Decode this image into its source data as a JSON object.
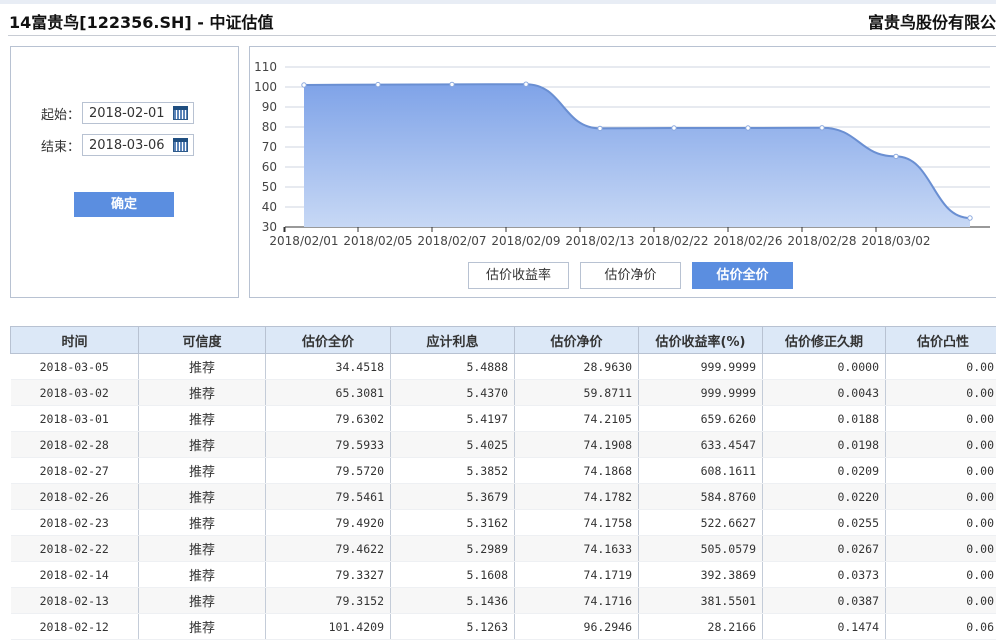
{
  "header": {
    "title": "14富贵鸟[122356.SH] - 中证估值",
    "company": "富贵鸟股份有限公"
  },
  "filter": {
    "start_label": "起始：",
    "start_value": "2018-02-01",
    "end_label": "结束：",
    "end_value": "2018-03-06",
    "confirm": "确定"
  },
  "chart_tabs": [
    {
      "label": "估价收益率"
    },
    {
      "label": "估价净价"
    },
    {
      "label": "估价全价",
      "active": true
    }
  ],
  "chart_data": {
    "type": "area",
    "title": "",
    "xlabel": "",
    "ylabel": "",
    "ylim": [
      30,
      110
    ],
    "yticks": [
      30,
      40,
      50,
      60,
      70,
      80,
      90,
      100,
      110
    ],
    "x": [
      "2018/02/01",
      "2018/02/05",
      "2018/02/07",
      "2018/02/09",
      "2018/02/13",
      "2018/02/22",
      "2018/02/26",
      "2018/02/28",
      "2018/03/02",
      "2018/03/05"
    ],
    "xtick_labels": [
      "2018/02/01",
      "2018/02/05",
      "2018/02/07",
      "2018/02/09",
      "2018/02/13",
      "2018/02/22",
      "2018/02/26",
      "2018/02/28",
      "2018/03/02"
    ],
    "values": [
      101.0,
      101.2,
      101.3,
      101.4,
      79.3,
      79.5,
      79.5,
      79.6,
      65.3,
      34.5
    ],
    "grid": true,
    "color": "#5b8ee0"
  },
  "table": {
    "headers": [
      "时间",
      "可信度",
      "估价全价",
      "应计利息",
      "估价净价",
      "估价收益率(%)",
      "估价修正久期",
      "估价凸性"
    ],
    "rows": [
      [
        "2018-03-05",
        "推荐",
        "34.4518",
        "5.4888",
        "28.9630",
        "999.9999",
        "0.0000",
        "0.00"
      ],
      [
        "2018-03-02",
        "推荐",
        "65.3081",
        "5.4370",
        "59.8711",
        "999.9999",
        "0.0043",
        "0.00"
      ],
      [
        "2018-03-01",
        "推荐",
        "79.6302",
        "5.4197",
        "74.2105",
        "659.6260",
        "0.0188",
        "0.00"
      ],
      [
        "2018-02-28",
        "推荐",
        "79.5933",
        "5.4025",
        "74.1908",
        "633.4547",
        "0.0198",
        "0.00"
      ],
      [
        "2018-02-27",
        "推荐",
        "79.5720",
        "5.3852",
        "74.1868",
        "608.1611",
        "0.0209",
        "0.00"
      ],
      [
        "2018-02-26",
        "推荐",
        "79.5461",
        "5.3679",
        "74.1782",
        "584.8760",
        "0.0220",
        "0.00"
      ],
      [
        "2018-02-23",
        "推荐",
        "79.4920",
        "5.3162",
        "74.1758",
        "522.6627",
        "0.0255",
        "0.00"
      ],
      [
        "2018-02-22",
        "推荐",
        "79.4622",
        "5.2989",
        "74.1633",
        "505.0579",
        "0.0267",
        "0.00"
      ],
      [
        "2018-02-14",
        "推荐",
        "79.3327",
        "5.1608",
        "74.1719",
        "392.3869",
        "0.0373",
        "0.00"
      ],
      [
        "2018-02-13",
        "推荐",
        "79.3152",
        "5.1436",
        "74.1716",
        "381.5501",
        "0.0387",
        "0.00"
      ],
      [
        "2018-02-12",
        "推荐",
        "101.4209",
        "5.1263",
        "96.2946",
        "28.2166",
        "0.1474",
        "0.06"
      ]
    ]
  }
}
